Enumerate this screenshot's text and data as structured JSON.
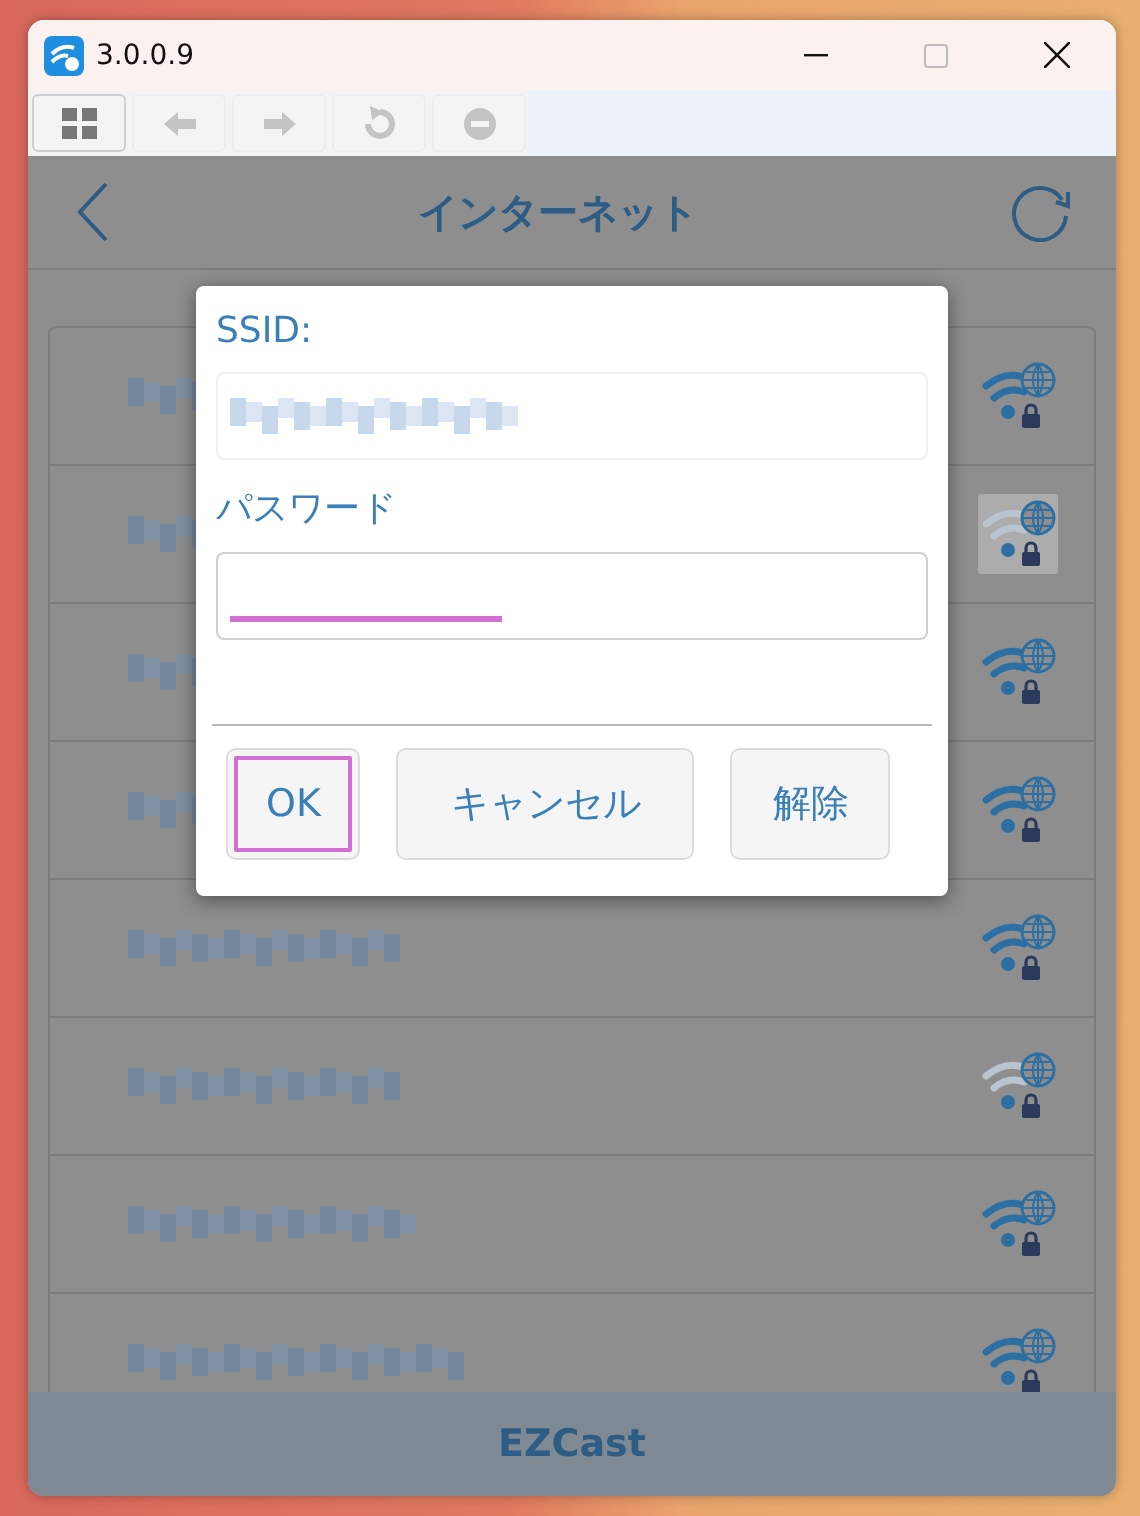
{
  "window": {
    "title": "3.0.0.9"
  },
  "toolbar": [
    {
      "kind": "grid",
      "disabled": false
    },
    {
      "kind": "back",
      "disabled": true
    },
    {
      "kind": "forward",
      "disabled": true
    },
    {
      "kind": "reload",
      "disabled": true
    },
    {
      "kind": "stop",
      "disabled": true
    }
  ],
  "header": {
    "title": "インターネット"
  },
  "networks": [
    {
      "weak": false,
      "highlighted": false
    },
    {
      "weak": true,
      "highlighted": true
    },
    {
      "weak": false,
      "highlighted": false
    },
    {
      "weak": false,
      "highlighted": false
    },
    {
      "weak": false,
      "highlighted": false
    },
    {
      "weak": true,
      "highlighted": false
    },
    {
      "weak": false,
      "highlighted": false
    },
    {
      "weak": false,
      "highlighted": false
    }
  ],
  "dialog": {
    "ssid_label": "SSID:",
    "password_label": "パスワード",
    "buttons": [
      {
        "label": "OK",
        "selected": true
      },
      {
        "label": "キャンセル",
        "selected": false
      },
      {
        "label": "解除",
        "selected": false
      }
    ]
  },
  "footer": {
    "title": "EZCast"
  }
}
